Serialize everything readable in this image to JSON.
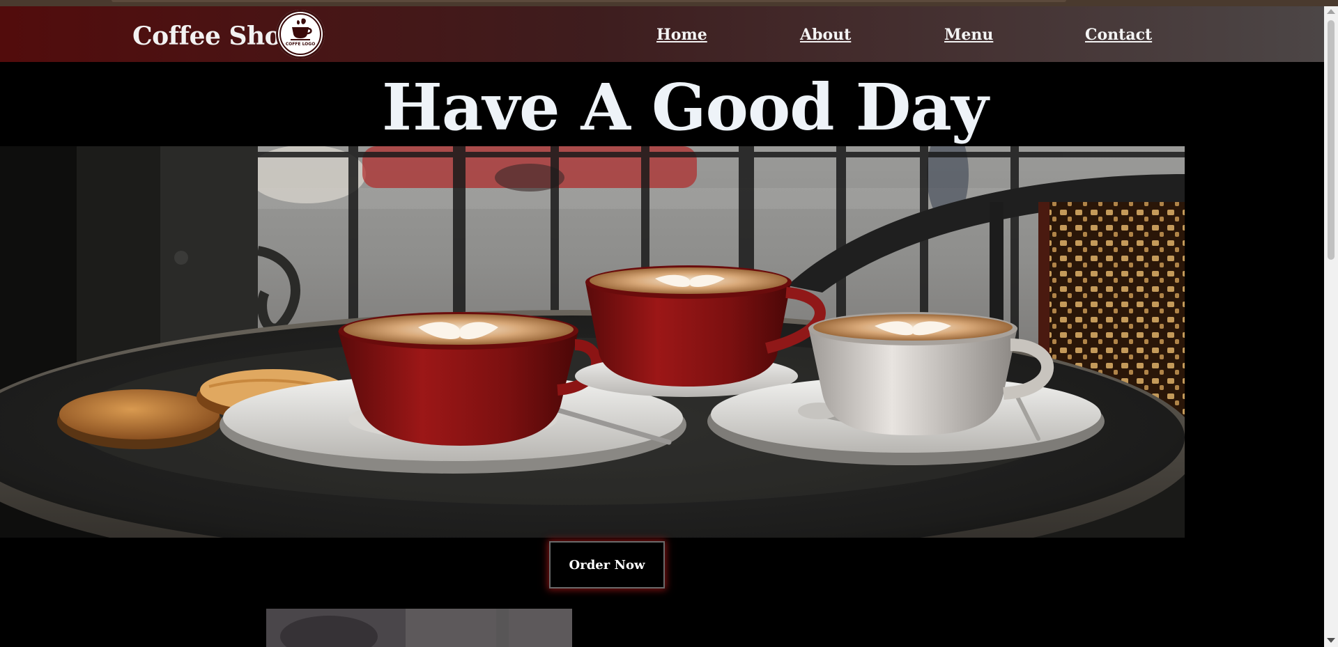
{
  "nav": {
    "brand": "Coffee Shop",
    "logo_text": "COFFE LOGO",
    "links": [
      "Home",
      "About",
      "Menu",
      "Contact"
    ]
  },
  "hero": {
    "title": "Have A Good Day",
    "image": "cafe-table-with-three-latte-cups-and-cookies"
  },
  "cta": {
    "order_label": "Order Now"
  },
  "colors": {
    "nav_gradient_start": "#520c0c",
    "nav_gradient_end": "#4c4646",
    "background": "#000000",
    "title": "#eef3f8",
    "cup_red": "#8c1414",
    "button_glow": "#961414"
  }
}
